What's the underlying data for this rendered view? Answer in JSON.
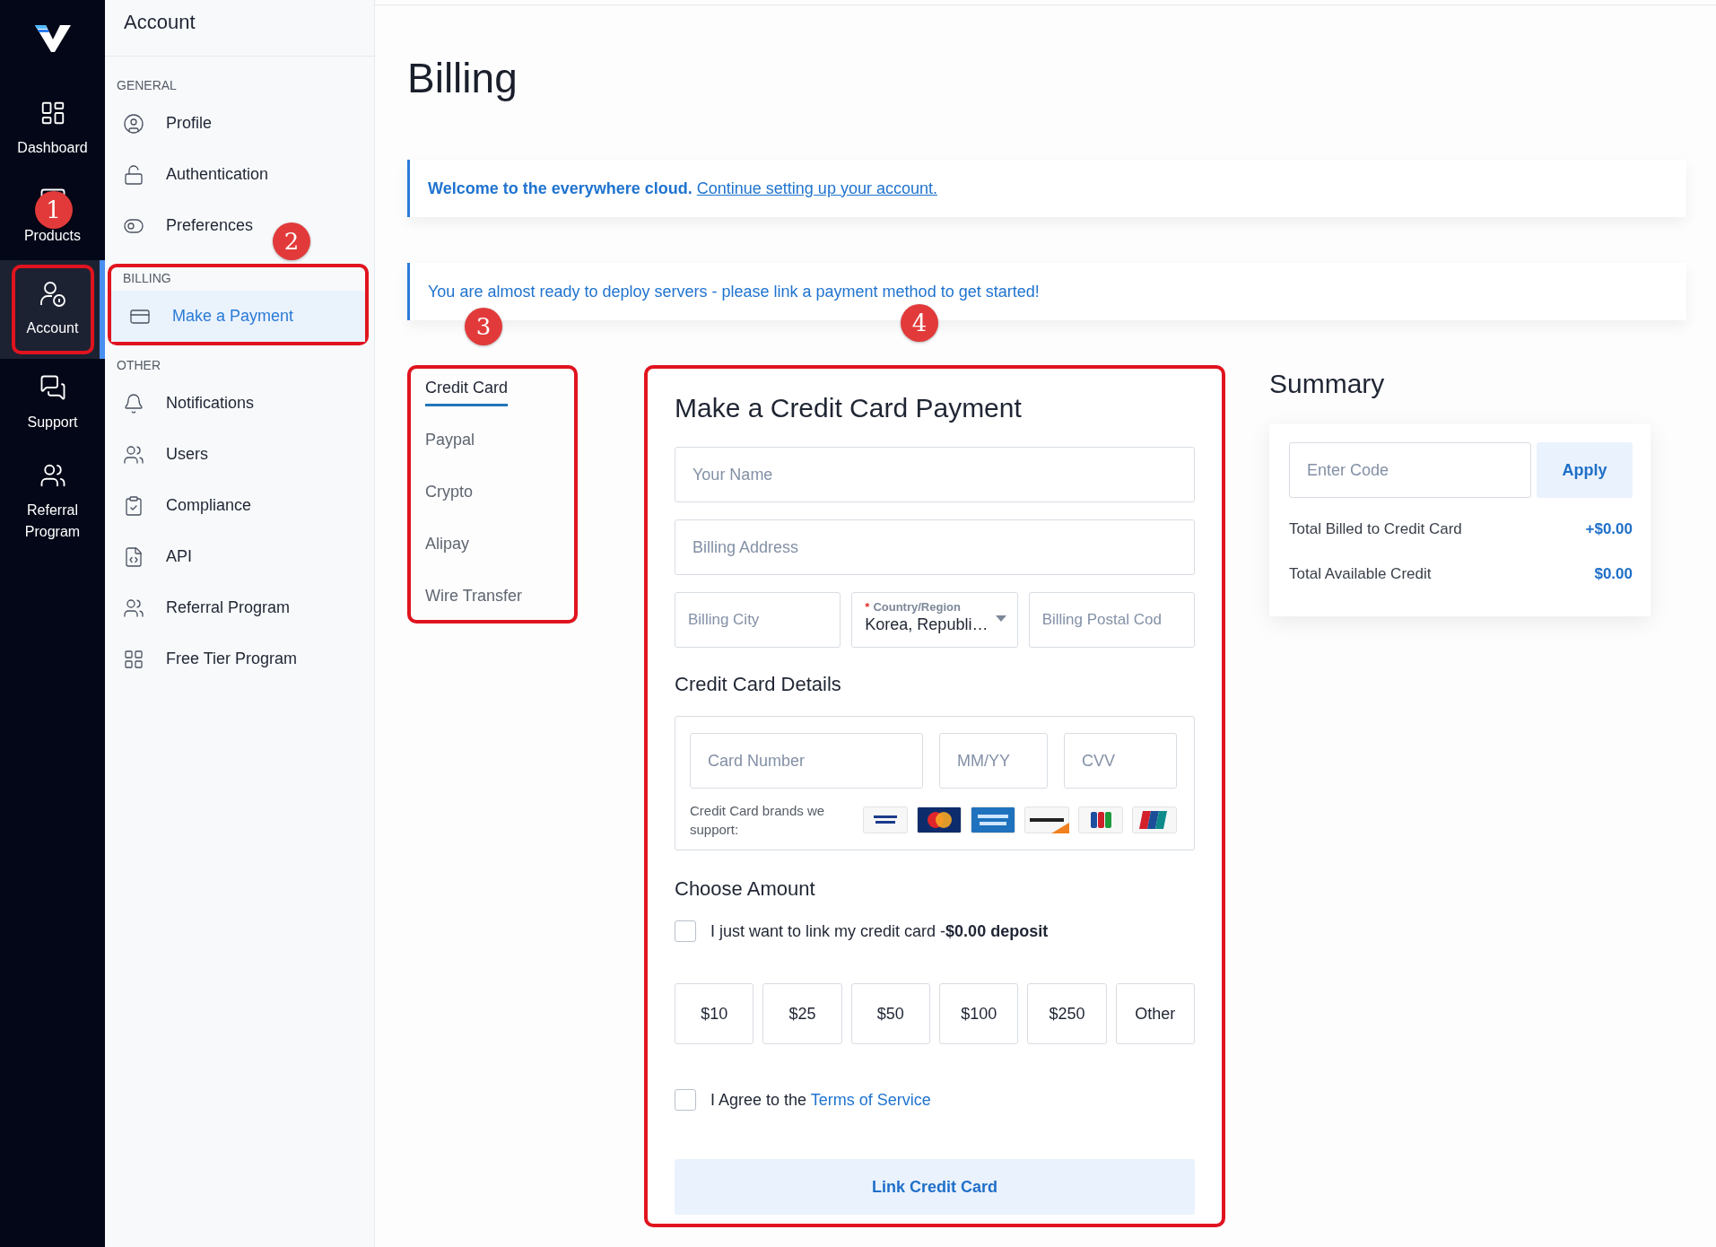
{
  "rail": {
    "items": [
      {
        "label": "Dashboard",
        "selected": false
      },
      {
        "label": "Products",
        "selected": false
      },
      {
        "label": "Account",
        "selected": true,
        "callout": "1"
      },
      {
        "label": "Support",
        "selected": false
      },
      {
        "label": "Referral Program",
        "selected": false
      }
    ]
  },
  "account_panel": {
    "title": "Account",
    "sections": [
      {
        "heading": "GENERAL",
        "items": [
          {
            "label": "Profile",
            "selected": false
          },
          {
            "label": "Authentication",
            "selected": false
          },
          {
            "label": "Preferences",
            "selected": false
          }
        ]
      },
      {
        "heading": "BILLING",
        "callout": "2",
        "items": [
          {
            "label": "Make a Payment",
            "selected": true
          }
        ]
      },
      {
        "heading": "OTHER",
        "items": [
          {
            "label": "Notifications",
            "selected": false
          },
          {
            "label": "Users",
            "selected": false
          },
          {
            "label": "Compliance",
            "selected": false
          },
          {
            "label": "API",
            "selected": false
          },
          {
            "label": "Referral Program",
            "selected": false
          },
          {
            "label": "Free Tier Program",
            "selected": false
          }
        ]
      }
    ]
  },
  "page_title": "Billing",
  "alerts": [
    {
      "kind": "welcome",
      "text": "**Welcome to the everywhere cloud.**",
      "link": "Continue setting up your account."
    },
    {
      "kind": "info",
      "text": "You are almost ready to deploy servers - please link a payment method to get started!"
    }
  ],
  "payment_methods": {
    "callout": "3",
    "tabs": [
      {
        "label": "Credit Card",
        "selected": true
      },
      {
        "label": "Paypal",
        "selected": false
      },
      {
        "label": "Crypto",
        "selected": false
      },
      {
        "label": "Alipay",
        "selected": false
      },
      {
        "label": "Wire Transfer",
        "selected": false
      }
    ]
  },
  "payment_form": {
    "callout": "4",
    "title": "Make a Credit Card Payment",
    "fields": [
      {
        "placeholder": "Your Name"
      },
      {
        "placeholder": "Billing Address"
      }
    ],
    "address_row": [
      {
        "kind": "input",
        "placeholder": "Billing City"
      },
      {
        "kind": "select",
        "required_mark": "*",
        "label": "Country/Region",
        "value": "Korea, Republi…"
      },
      {
        "kind": "input",
        "placeholder": "Billing Postal Cod"
      }
    ],
    "card_details": {
      "title": "Credit Card Details",
      "fields": [
        {
          "placeholder": "Card Number"
        },
        {
          "placeholder": "MM/YY"
        },
        {
          "placeholder": "CVV"
        }
      ],
      "brands_note": "Credit Card brands we support:"
    },
    "amount": {
      "title": "Choose Amount",
      "link_only": {
        "text": "I just want to link my credit card -**$0.00 deposit**",
        "checked": false
      },
      "options": [
        "$10",
        "$25",
        "$50",
        "$100",
        "$250",
        "Other"
      ]
    },
    "terms": {
      "text": "I Agree to the",
      "link": "Terms of Service",
      "checked": false
    },
    "submit": "Link Credit Card"
  },
  "summary": {
    "title": "Summary",
    "code_placeholder": "Enter Code",
    "apply": "Apply",
    "rows": [
      {
        "label": "Total Billed to Credit Card",
        "value": "+$0.00"
      },
      {
        "label": "Total Available Credit",
        "value": "$0.00"
      }
    ]
  }
}
